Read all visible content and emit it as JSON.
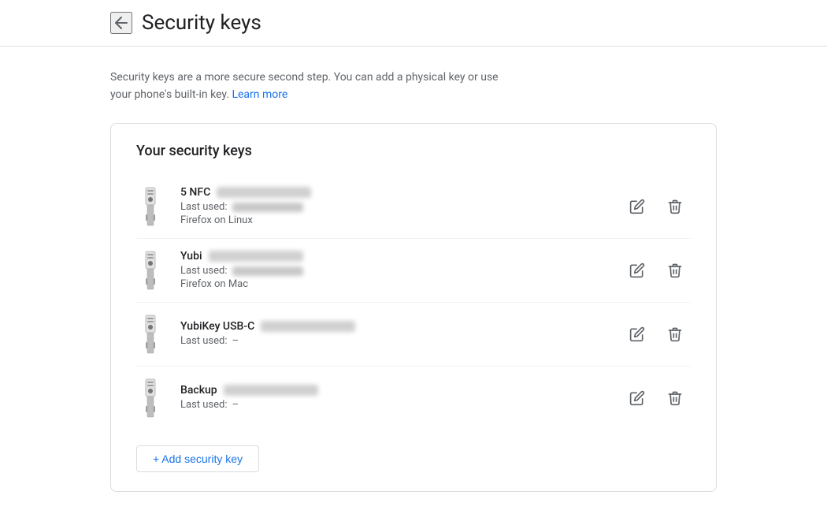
{
  "header": {
    "back_label": "Back",
    "title": "Security keys"
  },
  "description": {
    "text": "Security keys are a more secure second step. You can add a physical key or use your phone's built-in key.",
    "link_text": "Learn more",
    "link_href": "#"
  },
  "card": {
    "title": "Your security keys",
    "keys": [
      {
        "id": 1,
        "name": "5 NFC",
        "last_used_label": "Last used:",
        "last_used_value_blurred": true,
        "device": "Firefox on Linux",
        "show_device": true
      },
      {
        "id": 2,
        "name": "Yubi",
        "last_used_label": "Last used:",
        "last_used_value_blurred": true,
        "device": "Firefox on Mac",
        "show_device": true
      },
      {
        "id": 3,
        "name": "YubiKey USB-C",
        "last_used_label": "Last used:",
        "last_used_value": "–",
        "last_used_value_blurred": false,
        "device": "",
        "show_device": false
      },
      {
        "id": 4,
        "name": "Backup",
        "last_used_label": "Last used:",
        "last_used_value": "–",
        "last_used_value_blurred": false,
        "device": "",
        "show_device": false
      }
    ],
    "add_button_label": "+ Add security key"
  }
}
